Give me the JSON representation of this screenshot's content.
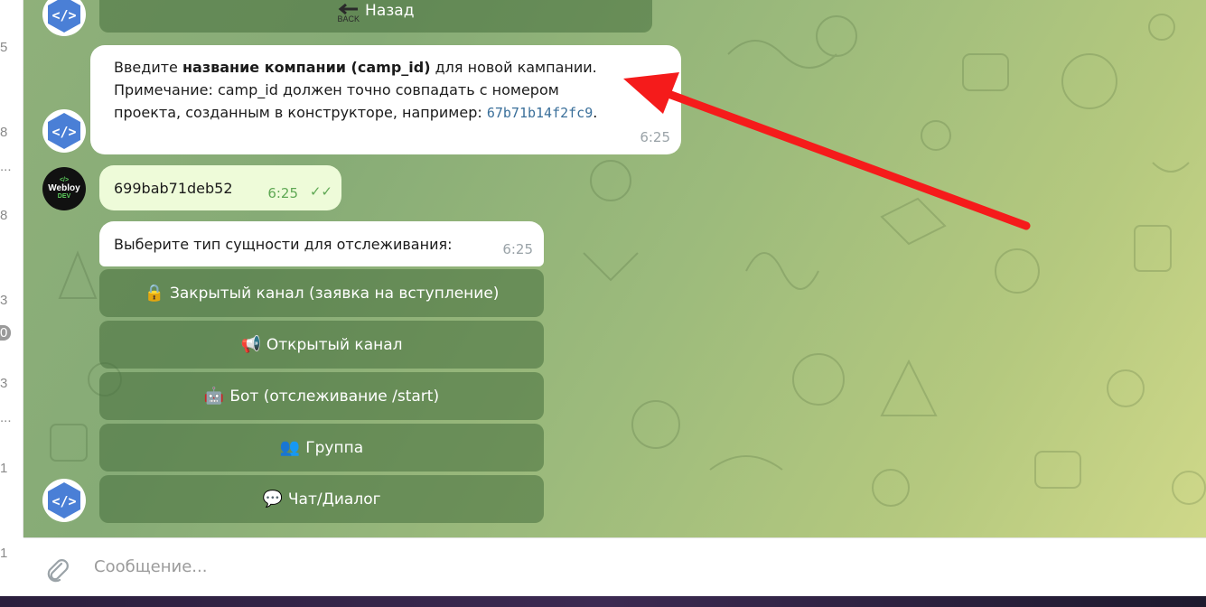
{
  "left_strip": {
    "digits": [
      "5",
      "8",
      "...",
      "8",
      "3",
      "0",
      "3",
      "...",
      "1",
      "1"
    ]
  },
  "back_button": {
    "label": "Назад",
    "sub": "BACK"
  },
  "messages": {
    "prompt": {
      "pre": "Введите ",
      "bold": "название компании (camp_id)",
      "post": " для новой кампании.",
      "line2": "Примечание: camp_id должен точно совпадать с номером",
      "line3": "проекта, созданным в конструкторе, например: ",
      "code": "67b71b14f2fc9",
      "dot": ".",
      "time": "6:25"
    },
    "user_reply": {
      "text": "699bab71deb52",
      "time": "6:25",
      "status": "read"
    },
    "choose": {
      "text": "Выберите тип сущности для отслеживания:",
      "time": "6:25"
    }
  },
  "user_avatar": {
    "name": "Webloy",
    "tag": "DEV"
  },
  "keyboard": [
    {
      "icon": "lock-icon",
      "emoji": "🔒",
      "label": "Закрытый канал (заявка на вступление)"
    },
    {
      "icon": "megaphone-icon",
      "emoji": "📢",
      "label": "Открытый канал"
    },
    {
      "icon": "robot-icon",
      "emoji": "🤖",
      "label": "Бот (отслеживание /start)"
    },
    {
      "icon": "people-icon",
      "emoji": "👥",
      "label": "Группа"
    },
    {
      "icon": "speech-icon",
      "emoji": "💬",
      "label": "Чат/Диалог"
    }
  ],
  "composer": {
    "placeholder": "Сообщение..."
  },
  "colors": {
    "annotation_arrow": "#f51b1b",
    "bot_avatar": "#4a7fd6"
  }
}
